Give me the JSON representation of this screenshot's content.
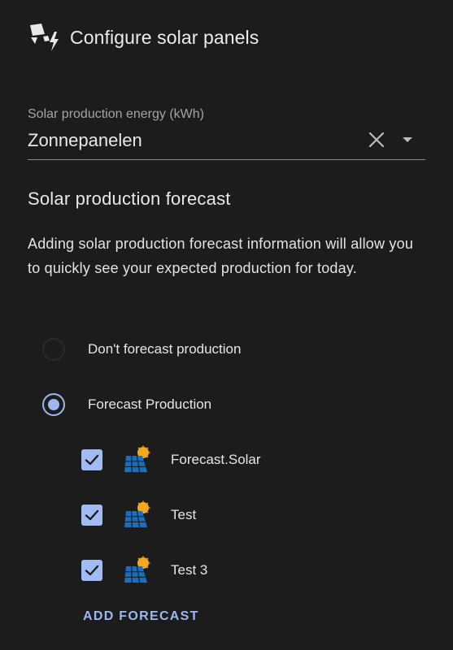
{
  "dialog": {
    "title": "Configure solar panels",
    "icon": "solar-power-icon"
  },
  "energy_select": {
    "label": "Solar production energy (kWh)",
    "value": "Zonnepanelen"
  },
  "forecast_section": {
    "title": "Solar production forecast",
    "description": "Adding solar production forecast information will allow you to quickly see your expected production for today."
  },
  "radio_options": [
    {
      "label": "Don't forecast production",
      "checked": false
    },
    {
      "label": "Forecast Production",
      "checked": true
    }
  ],
  "forecasts": [
    {
      "label": "Forecast.Solar",
      "checked": true,
      "icon": "solar-panel-icon"
    },
    {
      "label": "Test",
      "checked": true,
      "icon": "solar-panel-icon"
    },
    {
      "label": "Test 3",
      "checked": true,
      "icon": "solar-panel-icon"
    }
  ],
  "add_forecast_label": "ADD FORECAST",
  "colors": {
    "background": "#1c1c1c",
    "accent": "#9db8f0",
    "text": "#e6e6e6",
    "muted": "#a4a4a4"
  }
}
